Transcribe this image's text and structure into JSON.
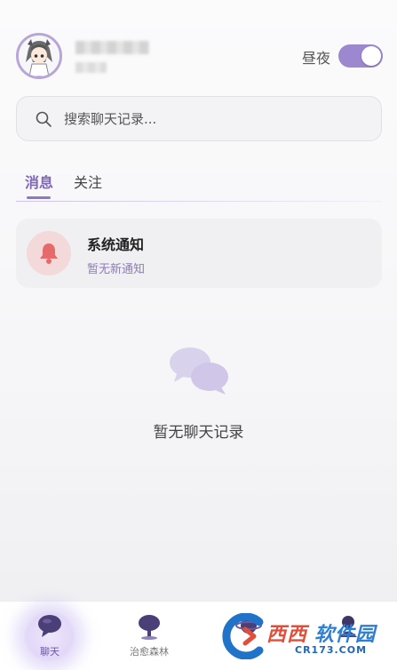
{
  "header": {
    "day_night_label": "昼夜",
    "day_night_on": true
  },
  "search": {
    "placeholder": "搜索聊天记录..."
  },
  "tabs": [
    {
      "label": "消息",
      "active": true
    },
    {
      "label": "关注",
      "active": false
    }
  ],
  "notice": {
    "title": "系统通知",
    "subtitle": "暂无新通知"
  },
  "empty": {
    "text": "暂无聊天记录"
  },
  "bottom_nav": [
    {
      "label": "聊天",
      "icon": "chat-bubble-icon",
      "active": true
    },
    {
      "label": "治愈森林",
      "icon": "tree-icon",
      "active": false
    },
    {
      "label": "",
      "icon": "planet-icon",
      "active": false
    },
    {
      "label": "",
      "icon": "profile-icon",
      "active": false
    }
  ],
  "watermark": {
    "brand_red": "西西",
    "brand_blue": "软件园",
    "domain": "CR173.COM"
  },
  "colors": {
    "accent": "#8d78c7",
    "notice_icon_bg": "#f4d9da",
    "bell": "#e66a6a"
  }
}
